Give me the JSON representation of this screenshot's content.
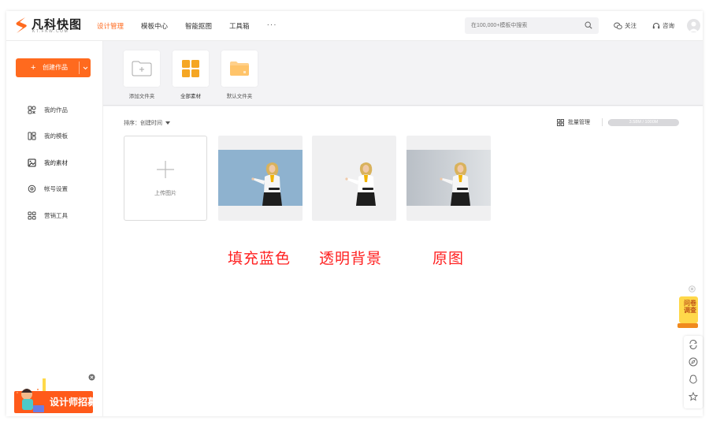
{
  "brand": {
    "name": "凡科快图",
    "sub": "KT.FKW.COM"
  },
  "nav": {
    "items": [
      {
        "label": "设计管理",
        "active": true
      },
      {
        "label": "模板中心",
        "active": false
      },
      {
        "label": "智能抠图",
        "active": false
      },
      {
        "label": "工具箱",
        "active": false
      }
    ],
    "more": "···"
  },
  "search": {
    "placeholder": "在100,000+模板中搜索"
  },
  "header": {
    "follow_label": "关注",
    "consult_label": "咨询"
  },
  "sidebar": {
    "create_label": "创建作品",
    "items": [
      {
        "label": "我的作品",
        "icon": "works-icon"
      },
      {
        "label": "我的模板",
        "icon": "template-icon"
      },
      {
        "label": "我的素材",
        "icon": "material-icon"
      },
      {
        "label": "帐号设置",
        "icon": "settings-icon"
      },
      {
        "label": "营销工具",
        "icon": "marketing-icon"
      }
    ],
    "recruit_label": "设计师招募"
  },
  "folders": [
    {
      "label": "添加文件夹"
    },
    {
      "label": "全部素材"
    },
    {
      "label": "默认文件夹"
    }
  ],
  "toolbar": {
    "sort_label": "排序：创建时间",
    "batch_label": "批量管理",
    "storage_text": "3.58M / 1000M",
    "storage_used_fraction": 0.0036
  },
  "upload": {
    "label": "上传图片"
  },
  "images": [
    {
      "name": "blue-background",
      "background": "#8eb2cf"
    },
    {
      "name": "transparent-background",
      "background": "#f0f0f1"
    },
    {
      "name": "original",
      "background": "#c9cdd2"
    }
  ],
  "captions": [
    "填充蓝色",
    "透明背景",
    "原图"
  ],
  "widgets": {
    "questionnaire_label": "问卷调查"
  },
  "colors": {
    "accent": "#ff6a1e",
    "caption": "#ff2020"
  }
}
